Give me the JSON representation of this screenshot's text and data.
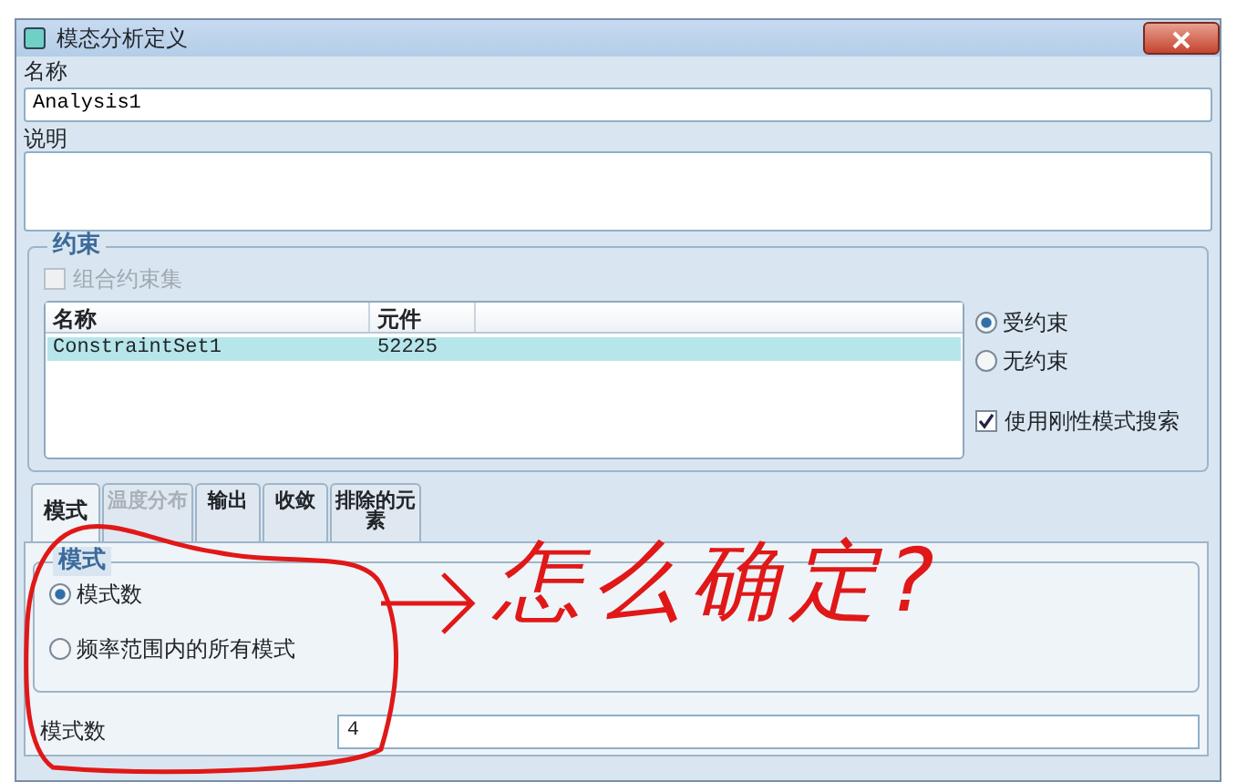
{
  "window": {
    "title": "模态分析定义"
  },
  "name_field": {
    "label": "名称",
    "value": "Analysis1"
  },
  "description_field": {
    "label": "说明"
  },
  "constraints": {
    "title": "约束",
    "combine_checkbox": {
      "label": "组合约束集",
      "checked": false,
      "disabled": true
    },
    "table": {
      "columns": [
        "名称",
        "元件"
      ],
      "rows": [
        {
          "cells": [
            "ConstraintSet1",
            "52225"
          ],
          "selected": true
        }
      ]
    },
    "options": [
      {
        "label": "受约束",
        "selected": true
      },
      {
        "label": "无约束",
        "selected": false
      }
    ],
    "rigid_checkbox": {
      "label": "使用刚性模式搜索",
      "checked": true
    }
  },
  "tabs": [
    {
      "label": "模式",
      "selected": true,
      "disabled": false
    },
    {
      "label": "温度分布",
      "selected": false,
      "disabled": true
    },
    {
      "label": "输出",
      "selected": false,
      "disabled": false
    },
    {
      "label": "收敛",
      "selected": false,
      "disabled": false
    },
    {
      "label": "排除的元素",
      "selected": false,
      "disabled": false
    }
  ],
  "modes": {
    "title": "模式",
    "options": [
      {
        "label": "模式数",
        "selected": true
      },
      {
        "label": "频率范围内的所有模式",
        "selected": false
      }
    ],
    "count_field": {
      "label": "模式数",
      "value": "4"
    }
  },
  "annotation": {
    "text": "怎么确定?"
  }
}
